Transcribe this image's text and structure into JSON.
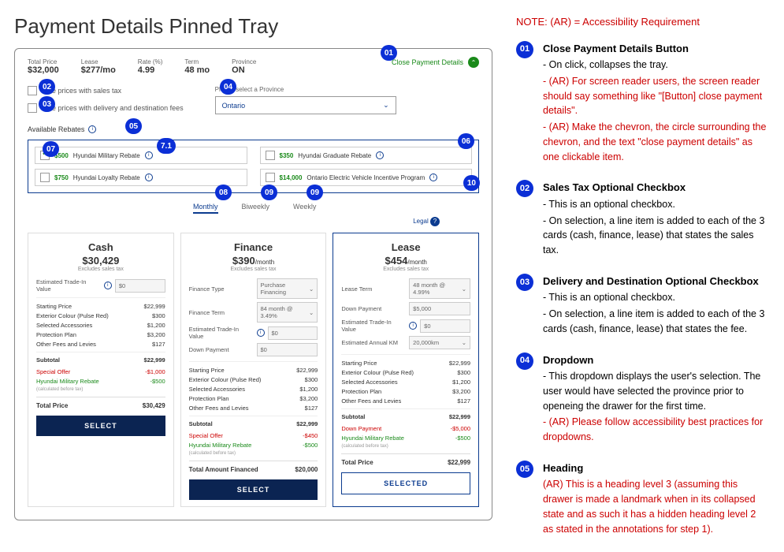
{
  "page_title": "Payment Details Pinned Tray",
  "summary": {
    "items": [
      {
        "label": "Total Price",
        "value": "$32,000"
      },
      {
        "label": "Lease",
        "value": "$277/mo"
      },
      {
        "label": "Rate (%)",
        "value": "4.99"
      },
      {
        "label": "Term",
        "value": "48 mo"
      },
      {
        "label": "Province",
        "value": "ON"
      }
    ]
  },
  "close_button_label": "Close Payment Details",
  "checkboxes": {
    "sales_tax": "See prices with sales tax",
    "delivery": "See prices with delivery and destination fees"
  },
  "province": {
    "label": "Please select a Province",
    "selected": "Ontario"
  },
  "rebates_heading": "Available Rebates",
  "rebates": [
    {
      "amount": "$500",
      "name": "Hyundai Military Rebate",
      "checked": true
    },
    {
      "amount": "$350",
      "name": "Hyundai Graduate Rebate",
      "checked": false
    },
    {
      "amount": "$750",
      "name": "Hyundai Loyalty Rebate",
      "checked": false
    },
    {
      "amount": "$14,000",
      "name": "Ontario Electric Vehicle Incentive Program",
      "checked": false
    }
  ],
  "tabs": {
    "monthly": "Monthly",
    "biweekly": "Biweekly",
    "weekly": "Weekly"
  },
  "legal": {
    "text": "Legal",
    "icon": "?"
  },
  "cards": {
    "cash": {
      "title": "Cash",
      "price": "$30,429",
      "excludes": "Excludes sales tax",
      "trade_label": "Estimated Trade-In Value",
      "trade_value": "$0",
      "items": [
        {
          "l": "Starting Price",
          "v": "$22,999"
        },
        {
          "l": "Exterior Colour (Pulse Red)",
          "v": "$300"
        },
        {
          "l": "Selected Accessories",
          "v": "$1,200"
        },
        {
          "l": "Protection Plan",
          "v": "$3,200"
        },
        {
          "l": "Other Fees and Levies",
          "v": "$127"
        }
      ],
      "subtotal_l": "Subtotal",
      "subtotal_v": "$22,999",
      "special_offer_l": "Special Offer",
      "special_offer_v": "-$1,000",
      "military_l": "Hyundai Military Rebate",
      "military_v": "-$500",
      "calc_note": "(calculated before tax)",
      "total_l": "Total Price",
      "total_v": "$30,429",
      "btn": "SELECT"
    },
    "finance": {
      "title": "Finance",
      "price": "$390",
      "per": "/month",
      "excludes": "Excludes sales tax",
      "fields": [
        {
          "l": "Finance Type",
          "v": "Purchase Financing",
          "dd": true
        },
        {
          "l": "Finance Term",
          "v": "84 month @ 3.49%",
          "dd": true
        },
        {
          "l": "Estimated Trade-In Value",
          "v": "$0"
        },
        {
          "l": "Down Payment",
          "v": "$0"
        }
      ],
      "items": [
        {
          "l": "Starting Price",
          "v": "$22,999"
        },
        {
          "l": "Exterior Colour (Pulse Red)",
          "v": "$300"
        },
        {
          "l": "Selected Accessories",
          "v": "$1,200"
        },
        {
          "l": "Protection Plan",
          "v": "$3,200"
        },
        {
          "l": "Other Fees and Levies",
          "v": "$127"
        }
      ],
      "subtotal_l": "Subtotal",
      "subtotal_v": "$22,999",
      "special_offer_l": "Special Offer",
      "special_offer_v": "-$450",
      "military_l": "Hyundai Military Rebate",
      "military_v": "-$500",
      "calc_note": "(calculated before tax)",
      "total_l": "Total Amount Financed",
      "total_v": "$20,000",
      "btn": "SELECT"
    },
    "lease": {
      "title": "Lease",
      "price": "$454",
      "per": "/month",
      "excludes": "Excludes sales tax",
      "fields": [
        {
          "l": "Lease Term",
          "v": "48 month @ 4.99%",
          "dd": true
        },
        {
          "l": "Down Payment",
          "v": "$5,000"
        },
        {
          "l": "Estimated Trade-In Value",
          "v": "$0"
        },
        {
          "l": "Estimated Annual KM",
          "v": "20,000km",
          "dd": true
        }
      ],
      "items": [
        {
          "l": "Starting Price",
          "v": "$22,999"
        },
        {
          "l": "Exterior Colour (Pulse Red)",
          "v": "$300"
        },
        {
          "l": "Selected Accessories",
          "v": "$1,200"
        },
        {
          "l": "Protection Plan",
          "v": "$3,200"
        },
        {
          "l": "Other Fees and Levies",
          "v": "$127"
        }
      ],
      "subtotal_l": "Subtotal",
      "subtotal_v": "$22,999",
      "down_l": "Down Payment",
      "down_v": "-$5,000",
      "military_l": "Hyundai Military Rebate",
      "military_v": "-$500",
      "calc_note": "(calculated before tax)",
      "total_l": "Total Price",
      "total_v": "$22,999",
      "btn": "SELECTED"
    }
  },
  "overlay_badges": [
    "01",
    "02",
    "03",
    "04",
    "05",
    "06",
    "07",
    "7.1",
    "08",
    "09",
    "09",
    "10"
  ],
  "right": {
    "ar_note": "NOTE: (AR) = Accessibility Requirement",
    "annotations": [
      {
        "num": "01",
        "title": "Close Payment Details Button",
        "lines": [
          {
            "t": "- On click, collapses the tray.",
            "red": false
          },
          {
            "t": "- (AR) For screen reader users, the screen reader should say something like \"[Button] close payment details\".",
            "red": true
          },
          {
            "t": "- (AR) Make the chevron, the circle surrounding the chevron, and the text \"close payment details\" as one clickable item.",
            "red": true
          }
        ]
      },
      {
        "num": "02",
        "title": "Sales Tax Optional Checkbox",
        "lines": [
          {
            "t": "- This is an optional checkbox.",
            "red": false
          },
          {
            "t": "- On selection, a line item is added to each of the 3 cards (cash, finance, lease) that states the sales tax.",
            "red": false
          }
        ]
      },
      {
        "num": "03",
        "title": "Delivery and Destination Optional Checkbox",
        "lines": [
          {
            "t": "- This is an optional checkbox.",
            "red": false
          },
          {
            "t": "- On selection, a line item is added to each of the 3 cards (cash, finance, lease) that states the fee.",
            "red": false
          }
        ]
      },
      {
        "num": "04",
        "title": "Dropdown",
        "lines": [
          {
            "t": "- This dropdown displays the user's selection. The user would have selected the province prior to openeing the drawer for the first time.",
            "red": false
          },
          {
            "t": "- (AR) Please follow accessibility best practices for dropdowns.",
            "red": true
          }
        ]
      },
      {
        "num": "05",
        "title": "Heading",
        "lines": [
          {
            "t": "(AR) This is a heading level 3 (assuming this drawer is made a landmark when in its collapsed state and as such it has a hidden heading level 2 as stated in the annotations for step 1).",
            "red": true
          }
        ]
      }
    ]
  }
}
